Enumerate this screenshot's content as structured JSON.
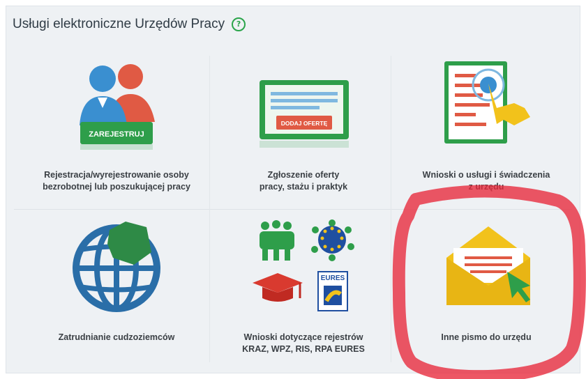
{
  "header": {
    "title": "Usługi elektroniczne Urzędów Pracy",
    "help_icon": "question-circle-icon"
  },
  "tiles": [
    {
      "icon": "users-register-icon",
      "button_label": "ZAREJESTRUJ",
      "label_line1": "Rejestracja/wyrejestrowanie osoby",
      "label_line2": "bezrobotnej lub poszukującej pracy"
    },
    {
      "icon": "job-offer-form-icon",
      "button_label": "DODAJ OFERTĘ",
      "label_line1": "Zgłoszenie oferty",
      "label_line2": "pracy, stażu i praktyk"
    },
    {
      "icon": "document-hand-icon",
      "label_line1": "Wnioski o usługi i świadczenia",
      "label_line2": "z urzędu"
    },
    {
      "icon": "globe-map-icon",
      "label_line1": "Zatrudnianie cudzoziemców"
    },
    {
      "icon": "registers-icons",
      "eures_text": "EURES",
      "label_line1": "Wnioski dotyczące rejestrów",
      "label_line2": "KRAZ, WPZ, RIS, RPA EURES"
    },
    {
      "icon": "envelope-cursor-icon",
      "label_line1": "Inne pismo do urzędu"
    }
  ],
  "colors": {
    "green": "#2e9e4a",
    "red": "#e05a44",
    "blue": "#3a8fd0",
    "yellow": "#f2c21b",
    "highlight": "#e8283a"
  }
}
